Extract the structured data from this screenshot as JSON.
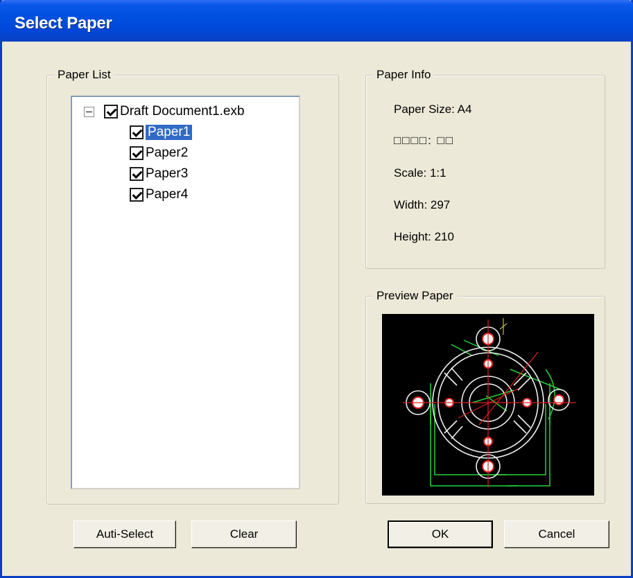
{
  "window": {
    "title": "Select Paper"
  },
  "paper_list": {
    "legend": "Paper List",
    "root": {
      "label": "Draft Document1.exb",
      "checked": true,
      "expanded": true
    },
    "items": [
      {
        "label": "Paper1",
        "checked": true,
        "selected": true
      },
      {
        "label": "Paper2",
        "checked": true,
        "selected": false
      },
      {
        "label": "Paper3",
        "checked": true,
        "selected": false
      },
      {
        "label": "Paper4",
        "checked": true,
        "selected": false
      }
    ]
  },
  "paper_info": {
    "legend": "Paper Info",
    "size": "Paper Size: A4",
    "garbled": "□□□□: □□",
    "scale": "Scale: 1:1",
    "width": "Width: 297",
    "height": "Height: 210"
  },
  "preview": {
    "legend": "Preview Paper"
  },
  "buttons": {
    "auto_select": "Auti-Select",
    "clear": "Clear",
    "ok": "OK",
    "cancel": "Cancel"
  }
}
